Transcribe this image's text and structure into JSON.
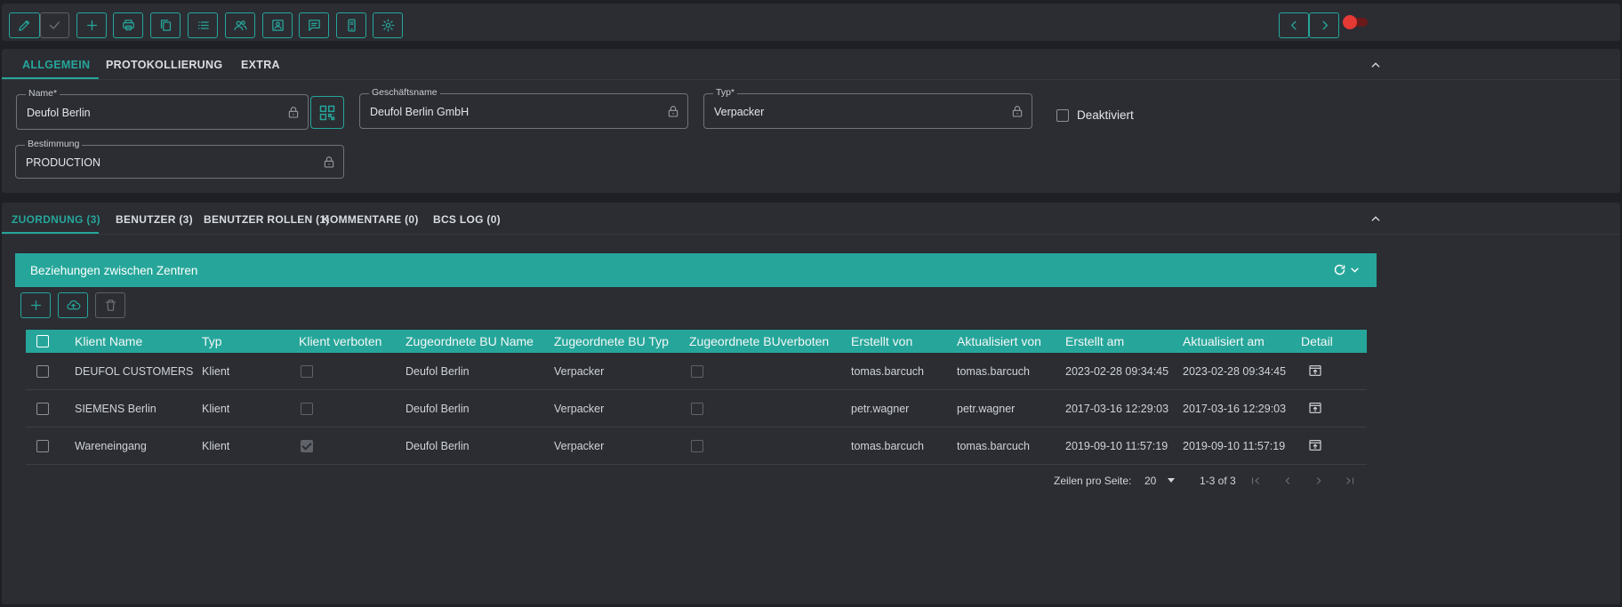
{
  "toolbar": {
    "buttons": [
      {
        "name": "edit",
        "icon": "pencil-icon"
      },
      {
        "name": "confirm",
        "icon": "check-icon"
      },
      {
        "name": "add",
        "icon": "plus-icon"
      },
      {
        "name": "print",
        "icon": "printer-icon"
      },
      {
        "name": "copy",
        "icon": "copy-icon"
      },
      {
        "name": "list",
        "icon": "list-icon"
      },
      {
        "name": "users",
        "icon": "users-icon"
      },
      {
        "name": "contact",
        "icon": "contact-card-icon"
      },
      {
        "name": "comment",
        "icon": "comment-icon"
      },
      {
        "name": "mobile",
        "icon": "mobile-icon"
      },
      {
        "name": "settings",
        "icon": "gear-icon"
      }
    ],
    "toggle_color": "#e53935"
  },
  "top_tabs": [
    {
      "label": "ALLGEMEIN",
      "active": true
    },
    {
      "label": "PROTOKOLLIERUNG",
      "active": false
    },
    {
      "label": "EXTRA",
      "active": false
    }
  ],
  "form": {
    "name": {
      "label": "Name*",
      "value": "Deufol Berlin"
    },
    "geschaeftsname": {
      "label": "Geschäftsname",
      "value": "Deufol Berlin GmbH"
    },
    "typ": {
      "label": "Typ*",
      "value": "Verpacker"
    },
    "deaktiviert": {
      "label": "Deaktiviert",
      "checked": false
    },
    "bestimmung": {
      "label": "Bestimmung",
      "value": "PRODUCTION"
    }
  },
  "bottom_tabs": [
    {
      "label": "ZUORDNUNG (3)",
      "active": true
    },
    {
      "label": "BENUTZER (3)",
      "active": false
    },
    {
      "label": "BENUTZER ROLLEN (1)",
      "active": false
    },
    {
      "label": "KOMMENTARE (0)",
      "active": false
    },
    {
      "label": "BCS LOG (0)",
      "active": false
    }
  ],
  "section": {
    "title": "Beziehungen zwischen Zentren",
    "accent": "#26a69a"
  },
  "table": {
    "headers": [
      "Klient Name",
      "Typ",
      "Klient verboten",
      "Zugeordnete BU Name",
      "Zugeordnete BU Typ",
      "Zugeordnete BUverboten",
      "Erstellt von",
      "Aktualisiert von",
      "Erstellt am",
      "Aktualisiert am",
      "Detail"
    ],
    "rows": [
      {
        "klient_name": "DEUFOL CUSTOMERS",
        "typ": "Klient",
        "klient_verboten": false,
        "bu_name": "Deufol Berlin",
        "bu_typ": "Verpacker",
        "bu_verboten": false,
        "erstellt_von": "tomas.barcuch",
        "aktualisiert_von": "tomas.barcuch",
        "erstellt_am": "2023-02-28 09:34:45",
        "aktualisiert_am": "2023-02-28 09:34:45"
      },
      {
        "klient_name": "SIEMENS Berlin",
        "typ": "Klient",
        "klient_verboten": false,
        "bu_name": "Deufol Berlin",
        "bu_typ": "Verpacker",
        "bu_verboten": false,
        "erstellt_von": "petr.wagner",
        "aktualisiert_von": "petr.wagner",
        "erstellt_am": "2017-03-16 12:29:03",
        "aktualisiert_am": "2017-03-16 12:29:03"
      },
      {
        "klient_name": "Wareneingang",
        "typ": "Klient",
        "klient_verboten": true,
        "bu_name": "Deufol Berlin",
        "bu_typ": "Verpacker",
        "bu_verboten": false,
        "erstellt_von": "tomas.barcuch",
        "aktualisiert_von": "tomas.barcuch",
        "erstellt_am": "2019-09-10 11:57:19",
        "aktualisiert_am": "2019-09-10 11:57:19"
      }
    ]
  },
  "pagination": {
    "rows_label": "Zeilen pro Seite:",
    "rows_value": "20",
    "range": "1-3 of 3"
  }
}
